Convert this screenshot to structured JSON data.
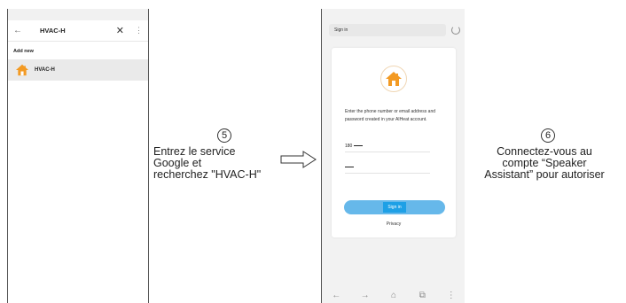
{
  "phone1": {
    "toolbar": {
      "back_icon": "←",
      "title": "HVAC-H",
      "close_icon": "✕",
      "more_icon": "⋮"
    },
    "section_label": "Add new",
    "result": {
      "label": "HVAC-H",
      "icon": "house-icon"
    }
  },
  "step5": {
    "number": "5",
    "lines": [
      "Entrez le service",
      "Google et",
      "recherchez \"HVAC-H\""
    ]
  },
  "phone2": {
    "url_text": "Sign in",
    "description": "Enter the phone number or email address and password created in your AIHeat account.",
    "phone_value": "180",
    "signin_label": "Sign in",
    "privacy_label": "Privacy",
    "nav": {
      "back": "←",
      "forward": "→",
      "home": "⌂",
      "tabs": "⧉",
      "menu": "⋮"
    },
    "logo_icon": "house-icon"
  },
  "step6": {
    "number": "6",
    "lines": [
      "Connectez-vous au",
      "compte “Speaker",
      "Assistant” pour autoriser"
    ]
  },
  "colors": {
    "accent": "#1ea0e6",
    "signin_bar": "#66b8ea",
    "house_orange": "#f39a23"
  }
}
